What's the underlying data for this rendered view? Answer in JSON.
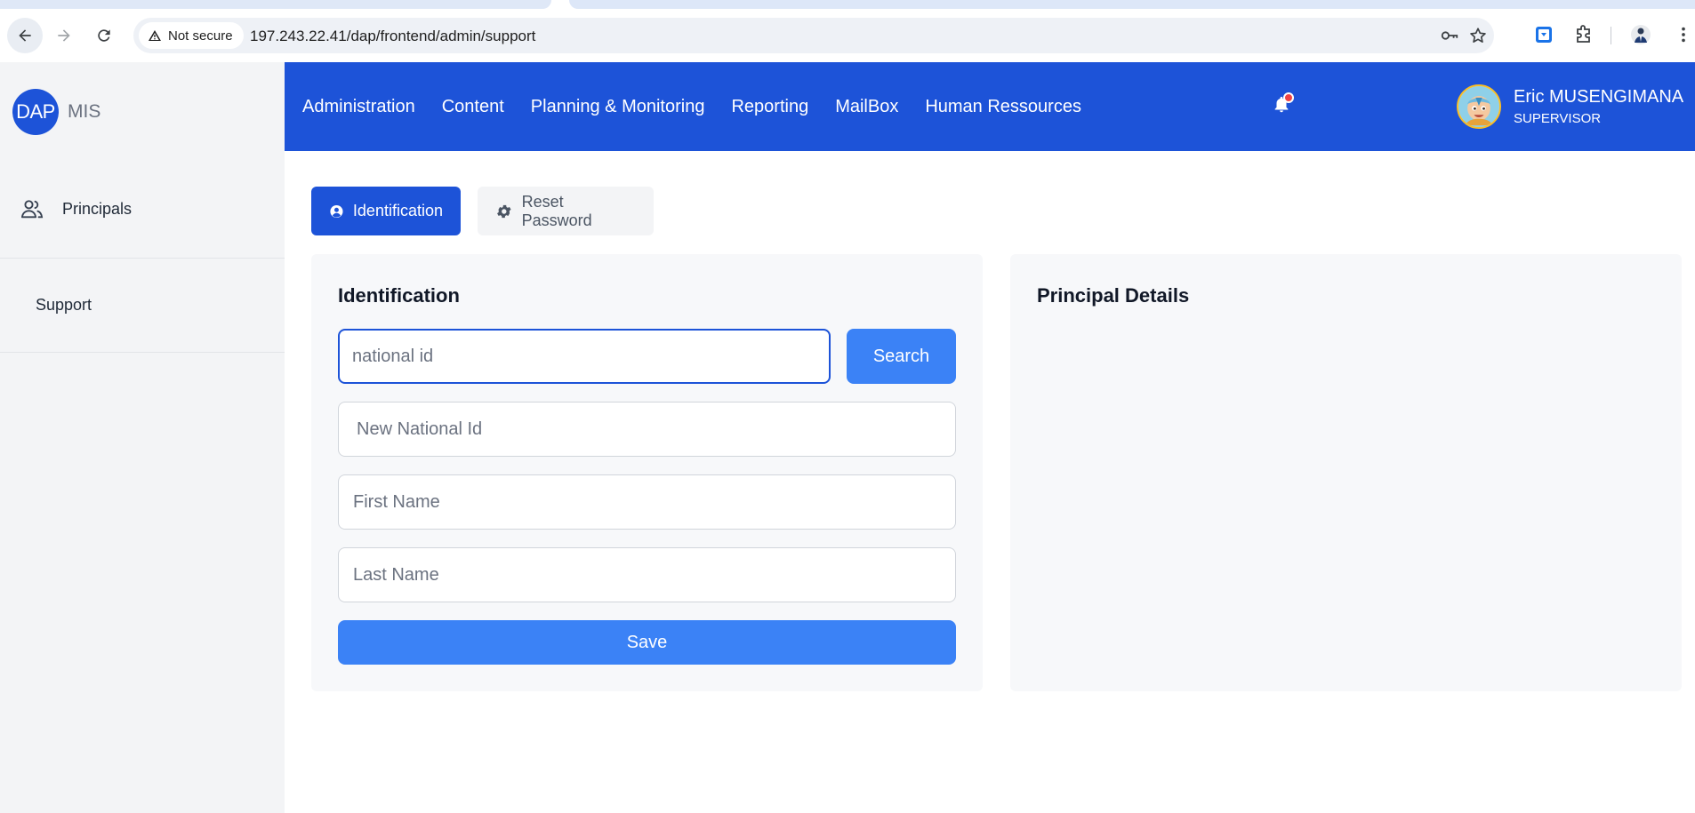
{
  "browser": {
    "security_label": "Not secure",
    "url": "197.243.22.41/dap/frontend/admin/support",
    "icons": [
      "back-icon",
      "forward-icon",
      "reload-icon",
      "warning-icon",
      "key-icon",
      "star-icon",
      "extension-icon",
      "puzzle-icon",
      "profile-icon",
      "kebab-menu-icon"
    ]
  },
  "brand": {
    "logo_text": "DAP",
    "name": "MIS",
    "color": "#1d53d8"
  },
  "sidebar": {
    "items": [
      {
        "label": "Principals",
        "icon": "users-icon"
      },
      {
        "label": "Support"
      }
    ]
  },
  "header": {
    "menu": [
      {
        "label": "Administration"
      },
      {
        "label": "Content"
      },
      {
        "label": "Planning & Monitoring"
      },
      {
        "label": "Reporting"
      },
      {
        "label": "MailBox"
      },
      {
        "label": "Human Ressources"
      }
    ],
    "notification_icon": "bell-icon",
    "user": {
      "name": "Eric MUSENGIMANA",
      "role": "SUPERVISOR"
    }
  },
  "tabs": [
    {
      "label": "Identification",
      "icon": "user-circle-icon",
      "active": true
    },
    {
      "label": "Reset Password",
      "icon": "gear-icon",
      "active": false
    }
  ],
  "identification": {
    "title": "Identification",
    "national_id": {
      "value": "",
      "placeholder": "national id"
    },
    "new_national_id": {
      "value": "",
      "placeholder": "New National Id"
    },
    "first_name": {
      "value": "",
      "placeholder": "First Name"
    },
    "last_name": {
      "value": "",
      "placeholder": "Last Name"
    },
    "search_label": "Search",
    "save_label": "Save"
  },
  "details": {
    "title": "Principal Details"
  },
  "colors": {
    "primary": "#1d53d8",
    "button": "#3b82f6",
    "notification": "#ef4444"
  }
}
